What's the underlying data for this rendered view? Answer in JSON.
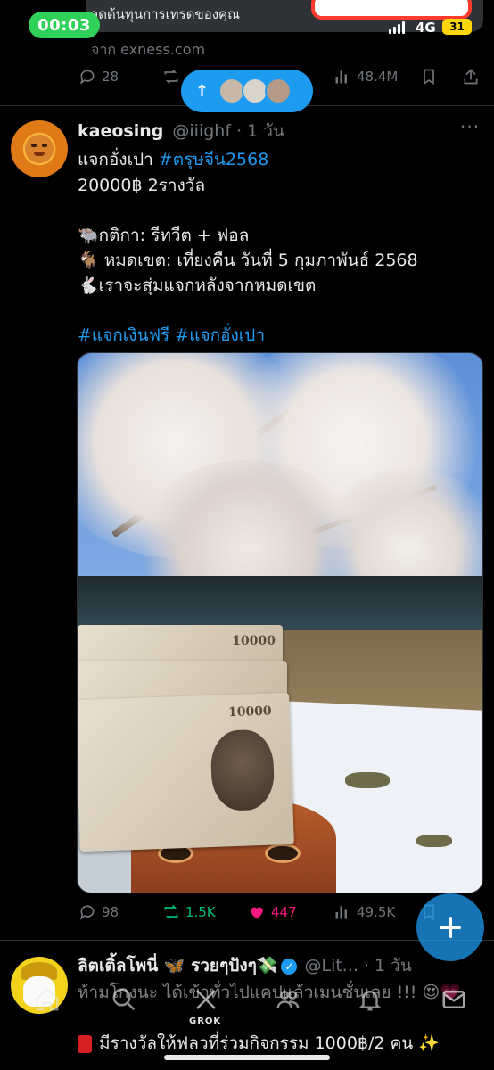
{
  "status_bar": {
    "time": "00:03",
    "network": "4G",
    "battery": "31"
  },
  "ad": {
    "banner_text": "ลดต้นทุนการเทรดของคุณ",
    "source": "จาก exness.com",
    "stats": {
      "replies": "28",
      "views": "48.4M"
    }
  },
  "new_posts_pill": {
    "arrow": "↑"
  },
  "tweet": {
    "author": "kaeosing",
    "handle": "@iiighf · 1 วัน",
    "line1_text": "แจกอั่งเปา ",
    "line1_hashtag": "#ตรุษจีน2568",
    "line2": "20000฿  2รางวัล",
    "rule1": "🐃กติกา: รีทวีต + ฟอล",
    "rule2": "🐐 หมดเขต: เที่ยงคืน วันที่ 5 กุมภาพันธ์ 2568",
    "rule3": "🐇เราจะสุ่มแจกหลังจากหมดเขต",
    "hashtag1": "#แจกเงินฟรี",
    "hashtag2": "#แจกอั่งเปา",
    "photo": {
      "bill_denomination": "10000"
    },
    "stats": {
      "replies": "98",
      "retweets": "1.5K",
      "likes": "447",
      "views": "49.5K"
    }
  },
  "tweet2": {
    "author": "ลิตเติ้ลโพนี่ 🦋 รวยๆปังๆ💸",
    "handle": "@Lit... · 1 วัน",
    "text": "ห้ามโกงนะ ได้เข้าทั่วไปแคปแล้วเมนชั่นเลย !!! 😍💗",
    "promo": "มีรางวัลให้ฟลวที่ร่วมกิจกรรม 1000฿/2 คน ✨"
  },
  "bottom_nav": {
    "grok_label": "GROK"
  },
  "colors": {
    "accent": "#1d9bf0",
    "retweet": "#00ba7c",
    "like": "#f91880",
    "muted": "#71767b",
    "time_pill": "#30d158",
    "battery": "#ffd60a"
  }
}
